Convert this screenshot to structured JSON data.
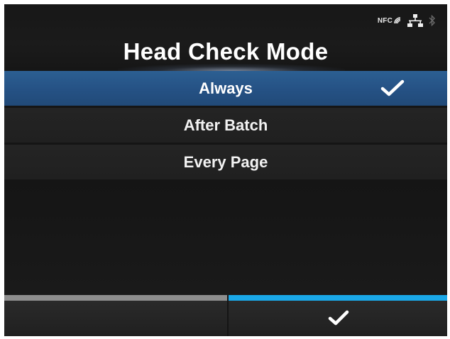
{
  "header": {
    "title": "Head Check Mode",
    "status_icons": {
      "nfc_label": "NFC",
      "icons": [
        "nfc-icon",
        "network-icon",
        "bluetooth-icon"
      ]
    }
  },
  "options": [
    {
      "label": "Always",
      "selected": true
    },
    {
      "label": "After Batch",
      "selected": false
    },
    {
      "label": "Every Page",
      "selected": false
    }
  ],
  "softkeys": {
    "left": {
      "icon": "",
      "accent": "#8e8e8e"
    },
    "right": {
      "icon": "checkmark-icon",
      "accent": "#1aa8e8"
    }
  },
  "colors": {
    "selected_row": "#255184",
    "background": "#151515",
    "accent_blue": "#1aa8e8"
  }
}
